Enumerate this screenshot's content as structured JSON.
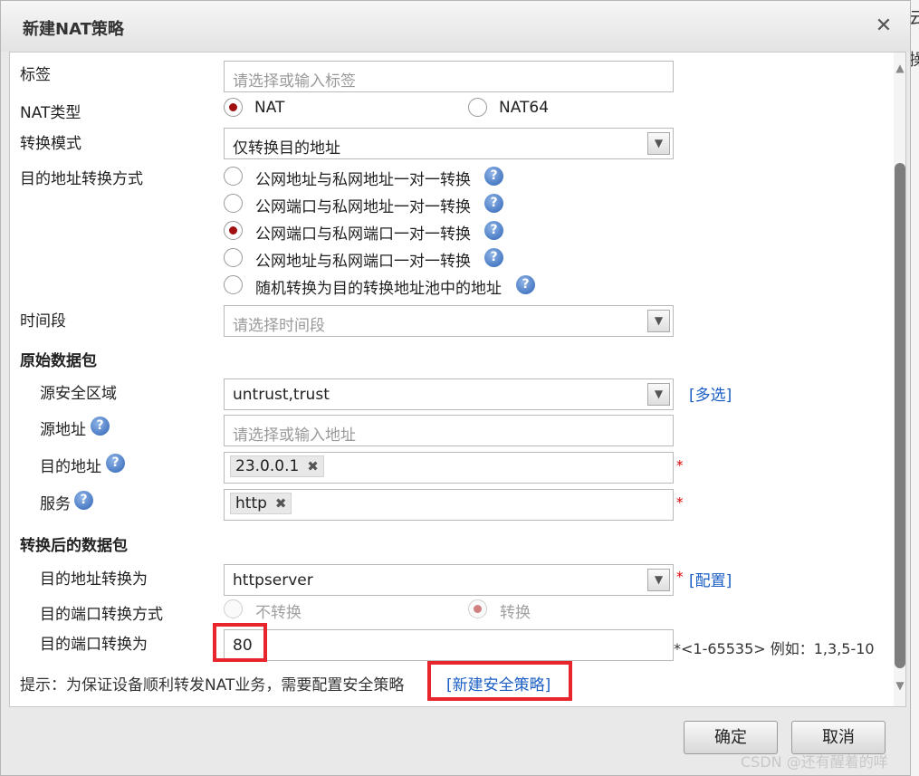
{
  "dialog": {
    "title": "新建NAT策略",
    "close_glyph": "✕"
  },
  "background": {
    "char1": "云",
    "char2": "操"
  },
  "form": {
    "tag": {
      "label": "标签",
      "placeholder": "请选择或输入标签"
    },
    "nat_type": {
      "label": "NAT类型",
      "options": [
        "NAT",
        "NAT64"
      ],
      "selected": "NAT"
    },
    "convert_mode": {
      "label": "转换模式",
      "value": "仅转换目的地址"
    },
    "dest_conv_method": {
      "label": "目的地址转换方式",
      "options": [
        "公网地址与私网地址一对一转换",
        "公网端口与私网地址一对一转换",
        "公网端口与私网端口一对一转换",
        "公网地址与私网端口一对一转换",
        "随机转换为目的转换地址池中的地址"
      ],
      "selected": "公网端口与私网端口一对一转换"
    },
    "time_range": {
      "label": "时间段",
      "placeholder": "请选择时间段"
    },
    "original_packet": {
      "heading": "原始数据包"
    },
    "src_zone": {
      "label": "源安全区域",
      "value": "untrust,trust",
      "multi_link": "[多选]"
    },
    "src_addr": {
      "label": "源地址",
      "placeholder": "请选择或输入地址"
    },
    "dest_addr": {
      "label": "目的地址",
      "tag": "23.0.0.1",
      "required": "*"
    },
    "service": {
      "label": "服务",
      "tag": "http",
      "required": "*"
    },
    "translated_packet": {
      "heading": "转换后的数据包"
    },
    "dest_addr_translated": {
      "label": "目的地址转换为",
      "value": "httpserver",
      "required": "*",
      "config_link": "[配置]"
    },
    "dest_port_method": {
      "label": "目的端口转换方式",
      "options": [
        "不转换",
        "转换"
      ],
      "selected": "转换"
    },
    "dest_port_translated": {
      "label": "目的端口转换为",
      "value": "80",
      "range_hint": "*<1-65535> 例如：1,3,5-10"
    },
    "hint": {
      "text": "提示：为保证设备顺利转发NAT业务，需要配置安全策略",
      "link": "[新建安全策略]"
    }
  },
  "buttons": {
    "ok": "确定",
    "cancel": "取消"
  },
  "watermark": "CSDN @还有醒着的咩",
  "icons": {
    "help": "?",
    "dropdown": "▼",
    "tag_remove": "✖",
    "scroll_up": "▲",
    "scroll_down": "▼"
  },
  "colors": {
    "link": "#1a5ec4",
    "highlight_box": "#e8242c",
    "radio_selected": "#a01010",
    "required": "#dd0000"
  }
}
